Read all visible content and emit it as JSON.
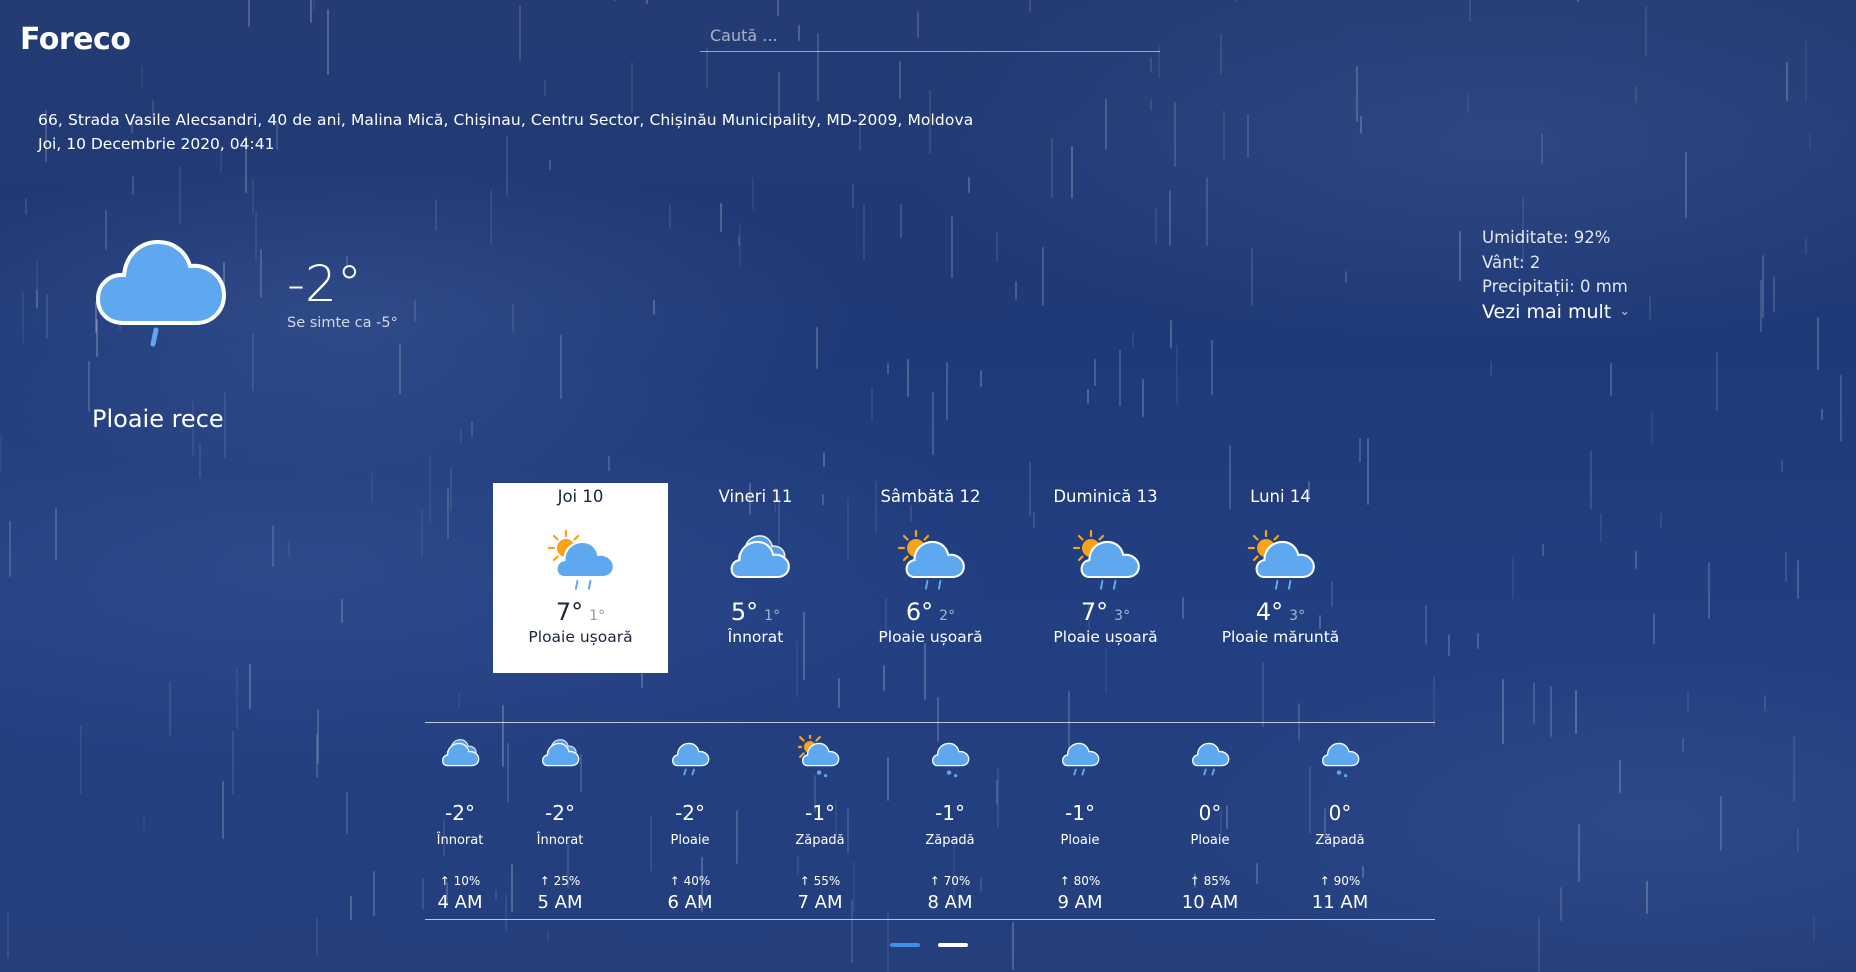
{
  "app": {
    "logo": "Foreco"
  },
  "search": {
    "placeholder": "Caută ..."
  },
  "location": {
    "address": "66, Strada Vasile Alecsandri, 40 de ani, Malina Mică, Chișinau, Centru Sector, Chișinău Municipality, MD-2009, Moldova",
    "datetime": "Joi, 10 Decembrie 2020, 04:41"
  },
  "current": {
    "icon": "rain-cloud-icon",
    "temp": "-2°",
    "feels_like": "Se simte ca -5°",
    "condition": "Ploaie rece"
  },
  "stats": {
    "humidity": "Umiditate: 92%",
    "wind": "Vânt: 2",
    "precip": "Precipitații: 0 mm",
    "more": "Vezi mai mult"
  },
  "days": [
    {
      "name": "Joi 10",
      "icon": "sun-rain-cloud-icon",
      "high": "7°",
      "low": "1°",
      "desc": "Ploaie ușoară",
      "active": true
    },
    {
      "name": "Vineri 11",
      "icon": "cloud-icon",
      "high": "5°",
      "low": "1°",
      "desc": "Înnorat",
      "active": false
    },
    {
      "name": "Sâmbătă 12",
      "icon": "sun-rain-cloud-icon",
      "high": "6°",
      "low": "2°",
      "desc": "Ploaie ușoară",
      "active": false
    },
    {
      "name": "Duminică 13",
      "icon": "sun-rain-cloud-icon",
      "high": "7°",
      "low": "3°",
      "desc": "Ploaie ușoară",
      "active": false
    },
    {
      "name": "Luni 14",
      "icon": "sun-drizzle-cloud-icon",
      "high": "4°",
      "low": "3°",
      "desc": "Ploaie măruntă",
      "active": false
    }
  ],
  "hours": [
    {
      "icon": "cloud-icon",
      "temp": "-2°",
      "desc": "Înnorat",
      "prob": "10%",
      "time": "4 AM"
    },
    {
      "icon": "cloud-icon",
      "temp": "-2°",
      "desc": "Înnorat",
      "prob": "25%",
      "time": "5 AM"
    },
    {
      "icon": "rain-cloud-icon",
      "temp": "-2°",
      "desc": "Ploaie",
      "prob": "40%",
      "time": "6 AM"
    },
    {
      "icon": "sun-snow-cloud-icon",
      "temp": "-1°",
      "desc": "Zăpadă",
      "prob": "55%",
      "time": "7 AM"
    },
    {
      "icon": "snow-cloud-icon",
      "temp": "-1°",
      "desc": "Zăpadă",
      "prob": "70%",
      "time": "8 AM"
    },
    {
      "icon": "rain-cloud-icon",
      "temp": "-1°",
      "desc": "Ploaie",
      "prob": "80%",
      "time": "9 AM"
    },
    {
      "icon": "rain-cloud-icon",
      "temp": "0°",
      "desc": "Ploaie",
      "prob": "85%",
      "time": "10 AM"
    },
    {
      "icon": "snow-cloud-icon",
      "temp": "0°",
      "desc": "Zăpadă",
      "prob": "90%",
      "time": "11 AM"
    }
  ],
  "colors": {
    "accent": "#3d8fe8",
    "cloud": "#5ea8f0",
    "sun": "#f5a31a",
    "active_card": "#ffffff"
  },
  "pager": {
    "active_index": 0,
    "count": 2
  }
}
